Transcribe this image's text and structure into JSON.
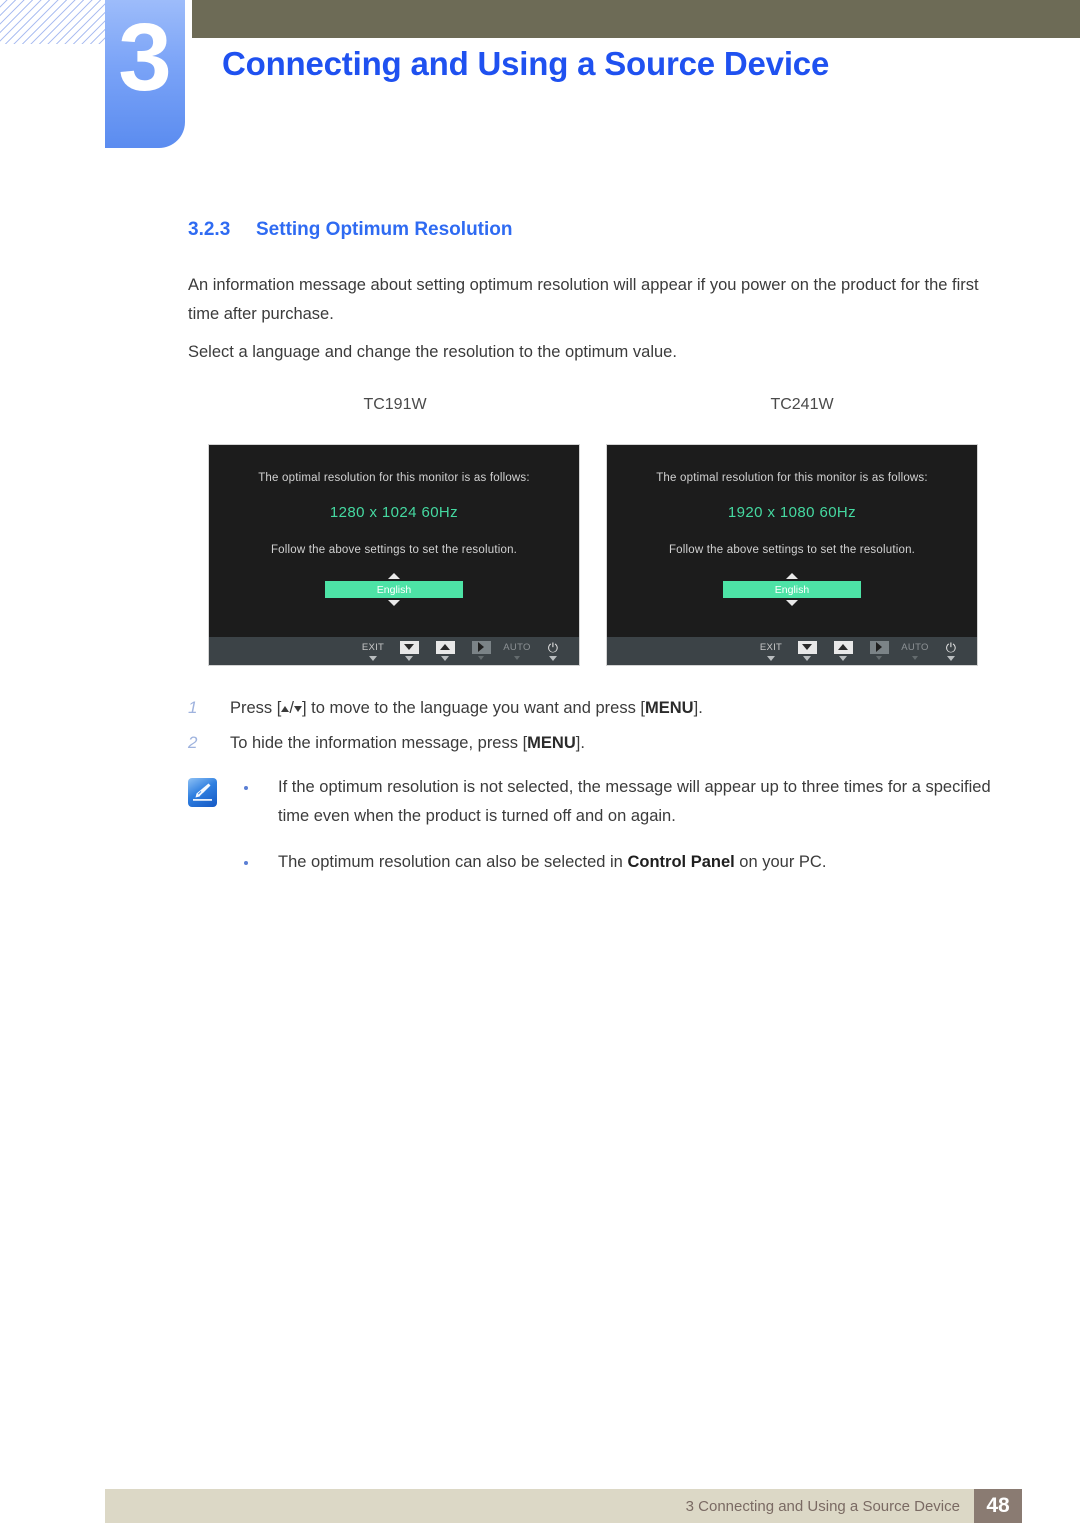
{
  "header": {
    "chapter_number": "3",
    "chapter_title": "Connecting and Using a Source Device"
  },
  "section": {
    "number": "3.2.3",
    "title": "Setting Optimum Resolution"
  },
  "body": {
    "paragraph_1": "An information message about setting optimum resolution will appear if you power on the product for the first time after purchase.",
    "paragraph_2": "Select a language and change the resolution to the optimum value."
  },
  "figures": [
    {
      "model": "TC191W",
      "osd": {
        "line1": "The optimal resolution for this monitor is as follows:",
        "resolution": "1280 x 1024 60Hz",
        "line2": "Follow the above settings to set the resolution.",
        "language": "English",
        "buttons": [
          "EXIT",
          "down-key",
          "up-key",
          "play-key",
          "AUTO",
          "power"
        ],
        "exit_label": "EXIT",
        "auto_label": "AUTO",
        "power_glyph": "⏻"
      }
    },
    {
      "model": "TC241W",
      "osd": {
        "line1": "The optimal resolution for this monitor is as follows:",
        "resolution": "1920 x 1080 60Hz",
        "line2": "Follow the above settings to set the resolution.",
        "language": "English",
        "buttons": [
          "EXIT",
          "down-key",
          "up-key",
          "play-key",
          "AUTO",
          "power"
        ],
        "exit_label": "EXIT",
        "auto_label": "AUTO",
        "power_glyph": "⏻"
      }
    }
  ],
  "steps": [
    {
      "index": "1",
      "prefix": "Press [",
      "middle": "/",
      "suffix": "] to move to the language you want and press [",
      "bold": "MENU",
      "end": "]."
    },
    {
      "index": "2",
      "text_before": "To hide the information message, press [",
      "bold": "MENU",
      "text_after": "]."
    }
  ],
  "notes": {
    "icon": "note-pencil-icon",
    "items": [
      {
        "text": "If the optimum resolution is not selected, the message will appear up to three times for a specified time even when the product is turned off and on again."
      },
      {
        "text_before": "The optimum resolution can also be selected in ",
        "bold": "Control Panel",
        "text_after": " on your PC."
      }
    ]
  },
  "footer": {
    "text": "3 Connecting and Using a Source Device",
    "page_number": "48"
  },
  "colors": {
    "accent_blue": "#1f51f0",
    "section_blue": "#2f6bf2",
    "olive_bar": "#6d6b56",
    "osd_background": "#1c1c1c",
    "osd_green": "#45d9a1",
    "highlight_green": "#4de3a6",
    "footer_bar": "#dcd8c6",
    "footer_page_box": "#8a7b72"
  }
}
